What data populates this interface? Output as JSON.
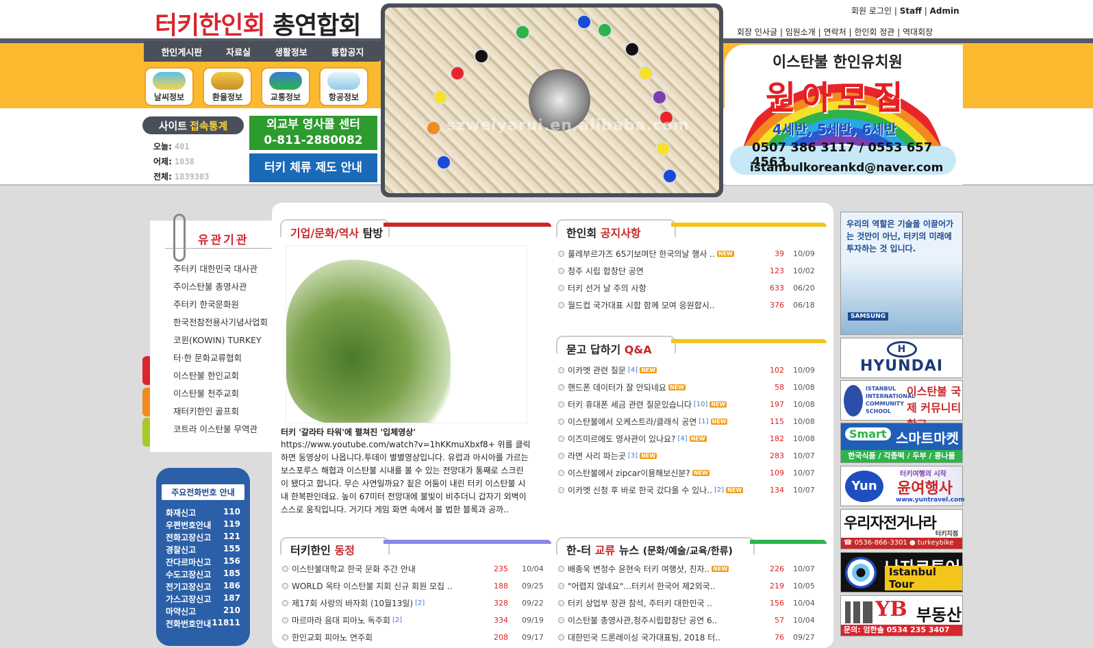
{
  "header": {
    "logo_red": "터키한인회",
    "logo_black": "총연합회",
    "menu": [
      "한인게시판",
      "자료실",
      "생활정보",
      "통합공지"
    ],
    "quick_icons": [
      "날씨정보",
      "환율정보",
      "교통정보",
      "항공정보"
    ],
    "top_links": {
      "login": "회원 로그인",
      "staff": "Staff",
      "admin": "Admin",
      "sep": "|"
    },
    "nav_links": [
      "회장 인사글",
      "임원소개",
      "연락처",
      "한인회 정관",
      "역대회장"
    ]
  },
  "stats": {
    "badge_a": "사이트",
    "badge_b": "접속통계",
    "rows": [
      {
        "label": "오늘:",
        "value": "401"
      },
      {
        "label": "어제:",
        "value": "1038"
      },
      {
        "label": "전체:",
        "value": "1839303"
      }
    ]
  },
  "banners": {
    "consul_line1": "외교부 영사콜 센터",
    "consul_line2": "0-811-2880082",
    "residence": "터키 체류 제도 안내"
  },
  "hero": {
    "watermark": "szweiyarui.en.alibaba.com"
  },
  "kindergarten": {
    "line1": "이스탄불 한인유치원",
    "line2": "원아모집",
    "line3": "4세반, 5세반, 6세반",
    "line4": "0507 386 3117 / 0553 657 4563",
    "line5": "istanbulkoreankd@naver.com"
  },
  "related": {
    "title": "유관기관",
    "items": [
      "주터키 대한민국 대사관",
      "주이스탄불 총영사관",
      "주터키 한국문화원",
      "한국전참전용사기념사업회",
      "코윈(KOWIN) TURKEY",
      "터·한 문화교류협회",
      "이스탄불 한인교회",
      "이스탄불 천주교회",
      "재터키한인 골프회",
      "코트라 이스탄불 무역관"
    ]
  },
  "phone": {
    "header": "주요전화번호 안내",
    "rows": [
      {
        "label": "화재신고",
        "num": "110"
      },
      {
        "label": "우편번호안내",
        "num": "119"
      },
      {
        "label": "전화고장신고",
        "num": "121"
      },
      {
        "label": "경찰신고",
        "num": "155"
      },
      {
        "label": "잔다르마신고",
        "num": "156"
      },
      {
        "label": "수도고장신고",
        "num": "185"
      },
      {
        "label": "전기고장신고",
        "num": "186"
      },
      {
        "label": "가스고장신고",
        "num": "187"
      },
      {
        "label": "마약신고",
        "num": "210"
      },
      {
        "label": "전화번호안내",
        "num": "11811"
      }
    ]
  },
  "sections": {
    "culture": {
      "title_a": "기업/문화/역사",
      "title_b": "탐방"
    },
    "notice": {
      "title_a": "한인회",
      "title_b": "공지사항",
      "items": [
        {
          "t": "룰레부르가즈 65기보며단 한국의날 행사 ..",
          "new": "NEW",
          "n": "39",
          "d": "10/09"
        },
        {
          "t": "청주 시립 합창단 공연",
          "n": "123",
          "d": "10/02"
        },
        {
          "t": "터키 선거 날 주의 사항",
          "n": "633",
          "d": "06/20"
        },
        {
          "t": "월드컵 국가대표 시합 함께 모여 응원합시..",
          "n": "376",
          "d": "06/18"
        }
      ]
    },
    "qna": {
      "title_a": "묻고 답하기",
      "title_b": "Q&A",
      "items": [
        {
          "t": "이카멧 관련 질문",
          "c": "[4]",
          "new": "NEW",
          "n": "102",
          "d": "10/09"
        },
        {
          "t": "핸드폰 데이터가 잘 안되네요",
          "new": "NEW",
          "n": "58",
          "d": "10/08"
        },
        {
          "t": "터키 휴대폰 세금 관련 질문있습니다",
          "c": "[10]",
          "new": "NEW",
          "n": "197",
          "d": "10/08"
        },
        {
          "t": "이스탄불에서 오케스트라/클래식 공연",
          "c": "[1]",
          "new": "NEW",
          "n": "115",
          "d": "10/08"
        },
        {
          "t": "이즈미르에도 영사관이 있나요?",
          "c": "[4]",
          "new": "NEW",
          "n": "182",
          "d": "10/08"
        },
        {
          "t": "라면 사리 파는곳",
          "c": "[3]",
          "new": "NEW",
          "n": "283",
          "d": "10/07"
        },
        {
          "t": "이스탄불에서 zipcar이용해보신분?",
          "new": "NEW",
          "n": "109",
          "d": "10/07"
        },
        {
          "t": "이카멧 신청 후 바로 한국 갔다올 수 있나..",
          "c": "[2]",
          "new": "NEW",
          "n": "134",
          "d": "10/07"
        }
      ]
    },
    "community": {
      "title_a": "터키한인",
      "title_b": "동정",
      "items": [
        {
          "t": "이스탄불대학교 한국 문화 주간 안내",
          "n": "235",
          "d": "10/04"
        },
        {
          "t": "WORLD 옥타 이스탄불 지회 신규 회원 모집 ..",
          "n": "188",
          "d": "09/25"
        },
        {
          "t": "제17회 사랑의 바자회 (10월13일)",
          "c": "[2]",
          "n": "328",
          "d": "09/22"
        },
        {
          "t": "마르마라 음대 피아노 독주회",
          "c": "[2]",
          "n": "334",
          "d": "09/19"
        },
        {
          "t": "한인교회 피아노 연주회",
          "n": "208",
          "d": "09/17"
        }
      ]
    },
    "exchange": {
      "title_a": "한-터",
      "title_b": "교류",
      "title_c": "뉴스",
      "title_d": "(문화/예술/교육/한류)",
      "items": [
        {
          "t": "배종욱 변정수 윤현숙 터키 여행샷, 친자..",
          "new": "NEW",
          "n": "226",
          "d": "10/07"
        },
        {
          "t": "\"어렵지 않네요\"…터키서 한국어 제2외국..",
          "n": "219",
          "d": "10/05"
        },
        {
          "t": "터키 상업부 장관 참석, 주터키 대한민국 ..",
          "n": "156",
          "d": "10/04"
        },
        {
          "t": "이스탄불 총영사관,청주시립합창단 공연 6..",
          "n": "57",
          "d": "10/04"
        },
        {
          "t": "대한민국 드론레이싱 국가대표팀, 2018 터..",
          "n": "76",
          "d": "09/27"
        }
      ]
    }
  },
  "story": {
    "title": "터키 '갈라타 타워'에 펼쳐진 '입체영상'",
    "body": "https://www.youtube.com/watch?v=1hKKmuXbxf8+ 위를 클릭 하면 동영상이 나옵니다.투데이 별별영상입니다. 유럽과 아시아를 가르는 보스포루스 해협과 이스탄불 시내를 볼 수 있는 전망대가 통째로 스크린이 됐다고 합니다. 무슨 사연일까요? 짙은 어둠이 내린 터키 이스탄불 시내 한복판인데요. 높이 67미터 전망대에 불빛이 비추더니 갑자기 외벽이 스스로 움직입니다. 거기다 게임 화면 속에서 볼 법한 블록과 공까.."
  },
  "ads": {
    "samsung_text": "우리의 역할은 기술을 이끌어가는 것만이 아닌, 터키의 미래에 투자하는 것 입니다.",
    "samsung_brand": "SAMSUNG",
    "hyundai": "HYUNDAI",
    "school_en": "ISTANBUL INTERNATIONAL COMMUNITY SCHOOL",
    "school_ko": "이스탄불 국제 커뮤니티학교",
    "smart_en": "Smart",
    "smart_ko": "스마트마켓",
    "smart_sub": "한국식품 / 각종떡 / 두부 / 콩나물",
    "yun_tag": "터키여행의 시작",
    "yun_ko": "윤여행사",
    "yun_url": "www.yuntravel.com",
    "yun_logo": "Yun",
    "bike_ko": "우리자전거나라",
    "bike_sub": "터키지점",
    "bike_phone": "☎ 0536-866-3301  ● turkeybike",
    "nazar_ko": "나자르투어",
    "nazar_en": "Istanbul Tour",
    "yb_a": "YB",
    "yb_b": "부동산",
    "yb_contact": "문의: 엄한솔  0534 235 3407"
  },
  "colors": {
    "brand_red": "#d8262e",
    "header_yellow": "#fbb930",
    "menu_dark": "#4a4f5a"
  }
}
